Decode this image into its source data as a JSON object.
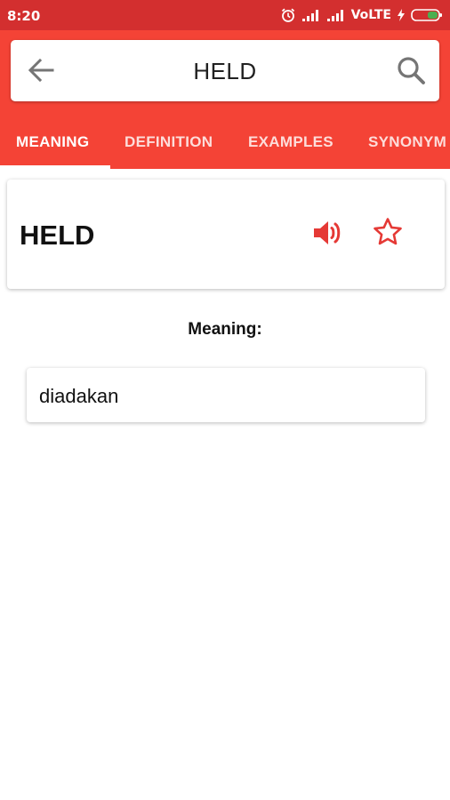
{
  "status_bar": {
    "time": "8:20",
    "network": "VoLTE",
    "icons": [
      "alarm-icon",
      "signal-icon",
      "signal-icon",
      "charging-icon",
      "battery-icon"
    ]
  },
  "search_bar": {
    "query": "HELD",
    "back_icon": "arrow-left-icon",
    "search_icon": "search-icon"
  },
  "tabs": [
    {
      "label": "MEANING",
      "active": true
    },
    {
      "label": "DEFINITION",
      "active": false
    },
    {
      "label": "EXAMPLES",
      "active": false
    },
    {
      "label": "SYNONYM",
      "active": false
    }
  ],
  "word_card": {
    "word": "HELD",
    "speaker_icon": "speaker-icon",
    "favorite_icon": "star-outline-icon"
  },
  "meaning": {
    "label": "Meaning:",
    "value": "diadakan"
  },
  "colors": {
    "status_bar": "#d32f2f",
    "app_bar": "#f44336",
    "accent": "#e53935",
    "battery_green": "#4caf50"
  }
}
